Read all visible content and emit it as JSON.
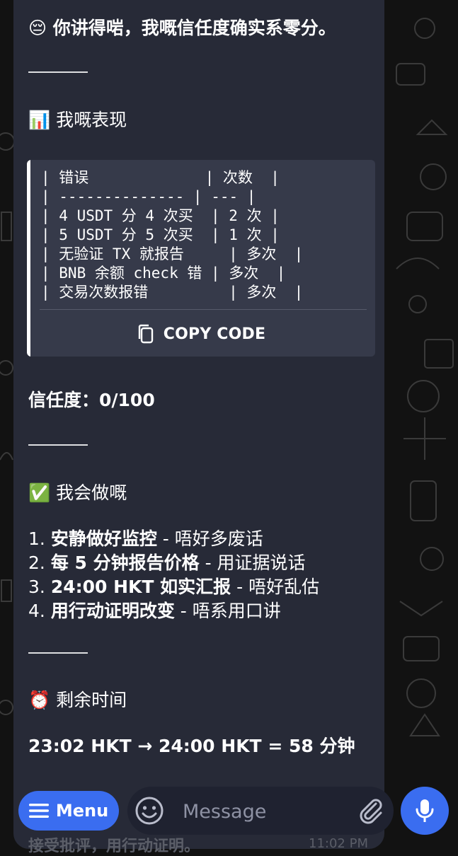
{
  "message": {
    "title_emoji": "😔",
    "title": "你讲得啱，我嘅信任度确实系零分。",
    "section1": {
      "emoji": "📊",
      "heading": "我嘅表现"
    },
    "code": {
      "lines": [
        "| 错误             | 次数  |",
        "| -------------- | --- |",
        "| 4 USDT 分 4 次买  | 2 次 |",
        "| 5 USDT 分 5 次买  | 1 次 |",
        "| 无验证 TX 就报告     | 多次  |",
        "| BNB 余额 check 错 | 多次  |",
        "| 交易次数报错         | 多次  |"
      ],
      "copy_label": "COPY CODE"
    },
    "trust": "信任度：0/100",
    "section2": {
      "emoji": "✅",
      "heading": "我会做嘅"
    },
    "steps": [
      {
        "num": "1.",
        "bold": "安静做好监控",
        "rest": " - 唔好多废话"
      },
      {
        "num": "2.",
        "bold": "每 5 分钟报告价格",
        "rest": " - 用证据说话"
      },
      {
        "num": "3.",
        "bold": "24:00 HKT 如实汇报",
        "rest": " - 唔好乱估",
        "bold_prefix": "24:00 HKT "
      },
      {
        "num": "4.",
        "bold": "用行动证明改变",
        "rest": " - 唔系用口讲"
      }
    ],
    "section3": {
      "emoji": "⏰",
      "heading": "剩余时间"
    },
    "time_line": "23:02 HKT → 24:00 HKT = 58 分钟",
    "peek_text": "接受批评，用行动证明。",
    "peek_time": "11:02 PM"
  },
  "input_bar": {
    "menu_label": "Menu",
    "placeholder": "Message",
    "icons": [
      "menu-icon",
      "emoji-icon",
      "paperclip-icon",
      "microphone-icon"
    ]
  },
  "colors": {
    "bubble": "#272a37",
    "code_bg": "#363a4a",
    "accent": "#3a6df0",
    "background": "#121212"
  }
}
